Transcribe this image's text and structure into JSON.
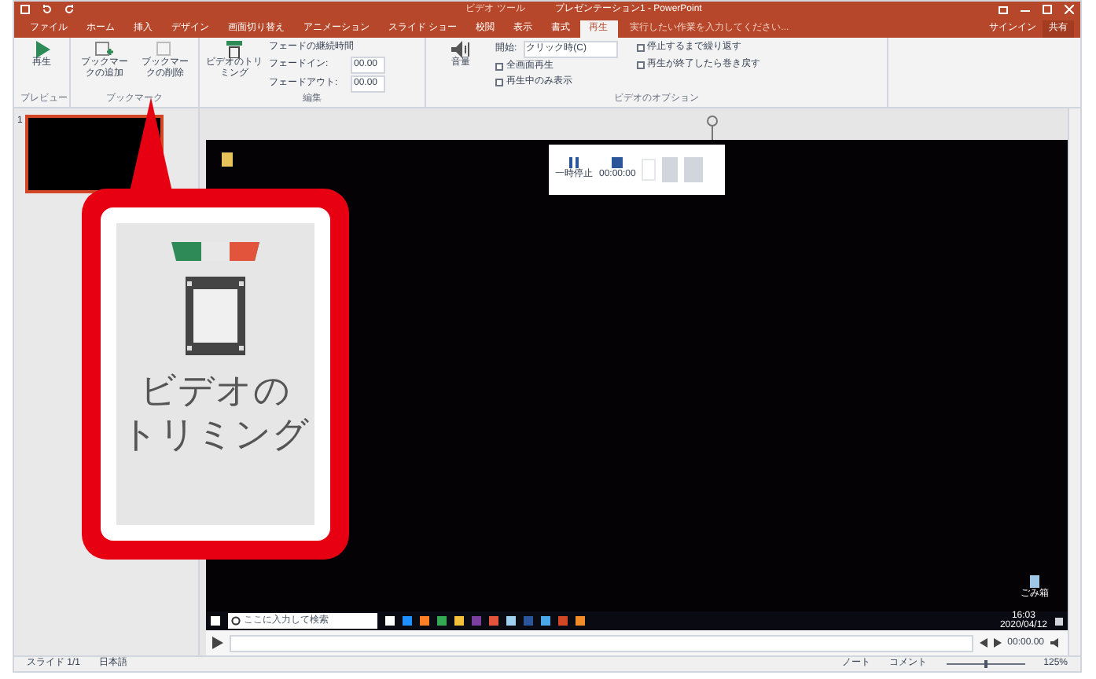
{
  "title_bar": {
    "context_label": "ビデオ ツール",
    "title": "プレゼンテーション1 - PowerPoint"
  },
  "tabs": [
    {
      "label": "ファイル",
      "selected": false
    },
    {
      "label": "ホーム",
      "selected": false
    },
    {
      "label": "挿入",
      "selected": false
    },
    {
      "label": "デザイン",
      "selected": false
    },
    {
      "label": "画面切り替え",
      "selected": false
    },
    {
      "label": "アニメーション",
      "selected": false
    },
    {
      "label": "スライド ショー",
      "selected": false
    },
    {
      "label": "校閲",
      "selected": false
    },
    {
      "label": "表示",
      "selected": false
    },
    {
      "label": "書式",
      "selected": false
    },
    {
      "label": "再生",
      "selected": true
    }
  ],
  "tell_me": "実行したい作業を入力してください...",
  "sign_in": "サインイン",
  "share": "共有",
  "ribbon": {
    "play": "再生",
    "add_bookmark": "ブックマークの追加",
    "remove_bookmark": "ブックマークの削除",
    "trim": "ビデオのトリミング",
    "fade_title": "フェードの継続時間",
    "fade_in": "フェードイン:",
    "fade_in_value": "00.00",
    "fade_out": "フェードアウト:",
    "fade_out_value": "00.00",
    "volume": "音量",
    "start_label": "開始:",
    "start_value": "クリック時(C)",
    "options": [
      {
        "label": "全画面再生",
        "checked": false
      },
      {
        "label": "再生中のみ表示",
        "checked": false
      },
      {
        "label": "停止するまで繰り返す",
        "checked": false
      },
      {
        "label": "再生が終了したら巻き戻す",
        "checked": false
      }
    ],
    "groups": [
      "プレビュー",
      "ブックマーク",
      "編集",
      "ビデオのオプション"
    ]
  },
  "slide_number": "1",
  "video": {
    "recorder": {
      "pause": "一時停止",
      "time": "00:00:00"
    },
    "search": "ここに入力して検索",
    "clock_time": "16:03",
    "clock_date": "2020/04/12",
    "recycle_bin": "ごみ箱"
  },
  "player_time": "00:00.00",
  "status_bar": {
    "slide": "スライド 1/1",
    "language": "日本語",
    "notes": "ノート",
    "comments": "コメント",
    "zoom_slider": {
      "level": 0.5
    },
    "zoom": "125%"
  },
  "callout": {
    "lines": [
      "ビデオの",
      "トリミング"
    ]
  }
}
